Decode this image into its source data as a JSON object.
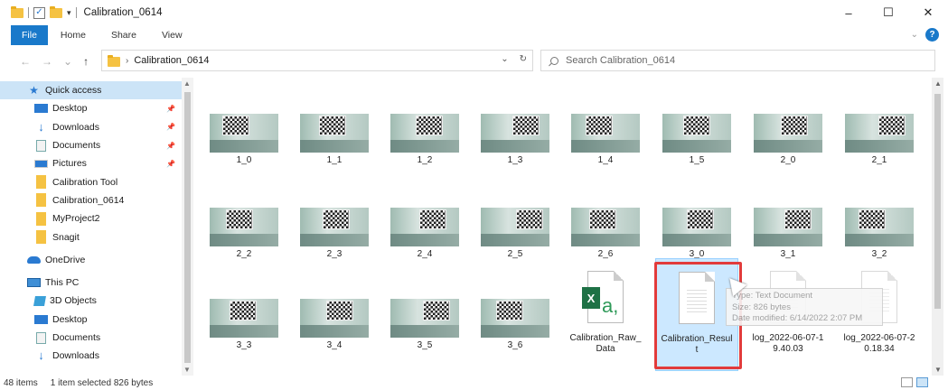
{
  "window": {
    "title": "Calibration_0614",
    "minimize": "–",
    "maximize": "☐",
    "close": "✕"
  },
  "ribbon": {
    "tabs": [
      "File",
      "Home",
      "Share",
      "View"
    ],
    "help": "?"
  },
  "nav": {
    "back": "←",
    "forward": "→",
    "recent": "⌄",
    "up": "↑"
  },
  "address": {
    "path": "Calibration_0614",
    "dropdown": "⌄",
    "refresh": "↻"
  },
  "search": {
    "placeholder": "Search Calibration_0614"
  },
  "sidebar": {
    "items": [
      {
        "label": "Quick access",
        "icon": "star-icon",
        "pinned": false
      },
      {
        "label": "Desktop",
        "icon": "desktop-icon",
        "pinned": true
      },
      {
        "label": "Downloads",
        "icon": "download-icon",
        "pinned": true
      },
      {
        "label": "Documents",
        "icon": "documents-icon",
        "pinned": true
      },
      {
        "label": "Pictures",
        "icon": "pictures-icon",
        "pinned": true
      },
      {
        "label": "Calibration Tool",
        "icon": "folder-icon",
        "pinned": false
      },
      {
        "label": "Calibration_0614",
        "icon": "folder-icon",
        "pinned": false
      },
      {
        "label": "MyProject2",
        "icon": "folder-icon",
        "pinned": false
      },
      {
        "label": "Snagit",
        "icon": "folder-icon",
        "pinned": false
      },
      {
        "label": "OneDrive",
        "icon": "cloud-icon",
        "pinned": false
      },
      {
        "label": "This PC",
        "icon": "pc-icon",
        "pinned": false
      },
      {
        "label": "3D Objects",
        "icon": "cube-icon",
        "pinned": false
      },
      {
        "label": "Desktop",
        "icon": "desktop-icon",
        "pinned": false
      },
      {
        "label": "Documents",
        "icon": "documents-icon",
        "pinned": false
      },
      {
        "label": "Downloads",
        "icon": "download-icon",
        "pinned": false
      }
    ]
  },
  "files": [
    {
      "name": "1_0",
      "type": "image"
    },
    {
      "name": "1_1",
      "type": "image"
    },
    {
      "name": "1_2",
      "type": "image"
    },
    {
      "name": "1_3",
      "type": "image"
    },
    {
      "name": "1_4",
      "type": "image"
    },
    {
      "name": "1_5",
      "type": "image"
    },
    {
      "name": "2_0",
      "type": "image"
    },
    {
      "name": "2_1",
      "type": "image"
    },
    {
      "name": "2_2",
      "type": "image"
    },
    {
      "name": "2_3",
      "type": "image"
    },
    {
      "name": "2_4",
      "type": "image"
    },
    {
      "name": "2_5",
      "type": "image"
    },
    {
      "name": "2_6",
      "type": "image"
    },
    {
      "name": "3_0",
      "type": "image"
    },
    {
      "name": "3_1",
      "type": "image"
    },
    {
      "name": "3_2",
      "type": "image"
    },
    {
      "name": "3_3",
      "type": "image"
    },
    {
      "name": "3_4",
      "type": "image"
    },
    {
      "name": "3_5",
      "type": "image"
    },
    {
      "name": "3_6",
      "type": "image"
    },
    {
      "name": "Calibration_Raw_\nData",
      "type": "excel"
    },
    {
      "name": "Calibration_Resul\nt",
      "type": "text",
      "selected": true
    },
    {
      "name": "log_2022-06-07-1\n9.40.03",
      "type": "text"
    },
    {
      "name": "log_2022-06-07-2\n0.18.34",
      "type": "text"
    }
  ],
  "tooltip": {
    "line1": "Type: Text Document",
    "line2": "Size: 826 bytes",
    "line3": "Date modified: 6/14/2022 2:07 PM"
  },
  "status": {
    "count": "48 items",
    "selection": "1 item selected  826 bytes"
  },
  "colors": {
    "accent": "#1979ca",
    "highlight": "#e23b3b",
    "selection": "#cce8ff"
  }
}
